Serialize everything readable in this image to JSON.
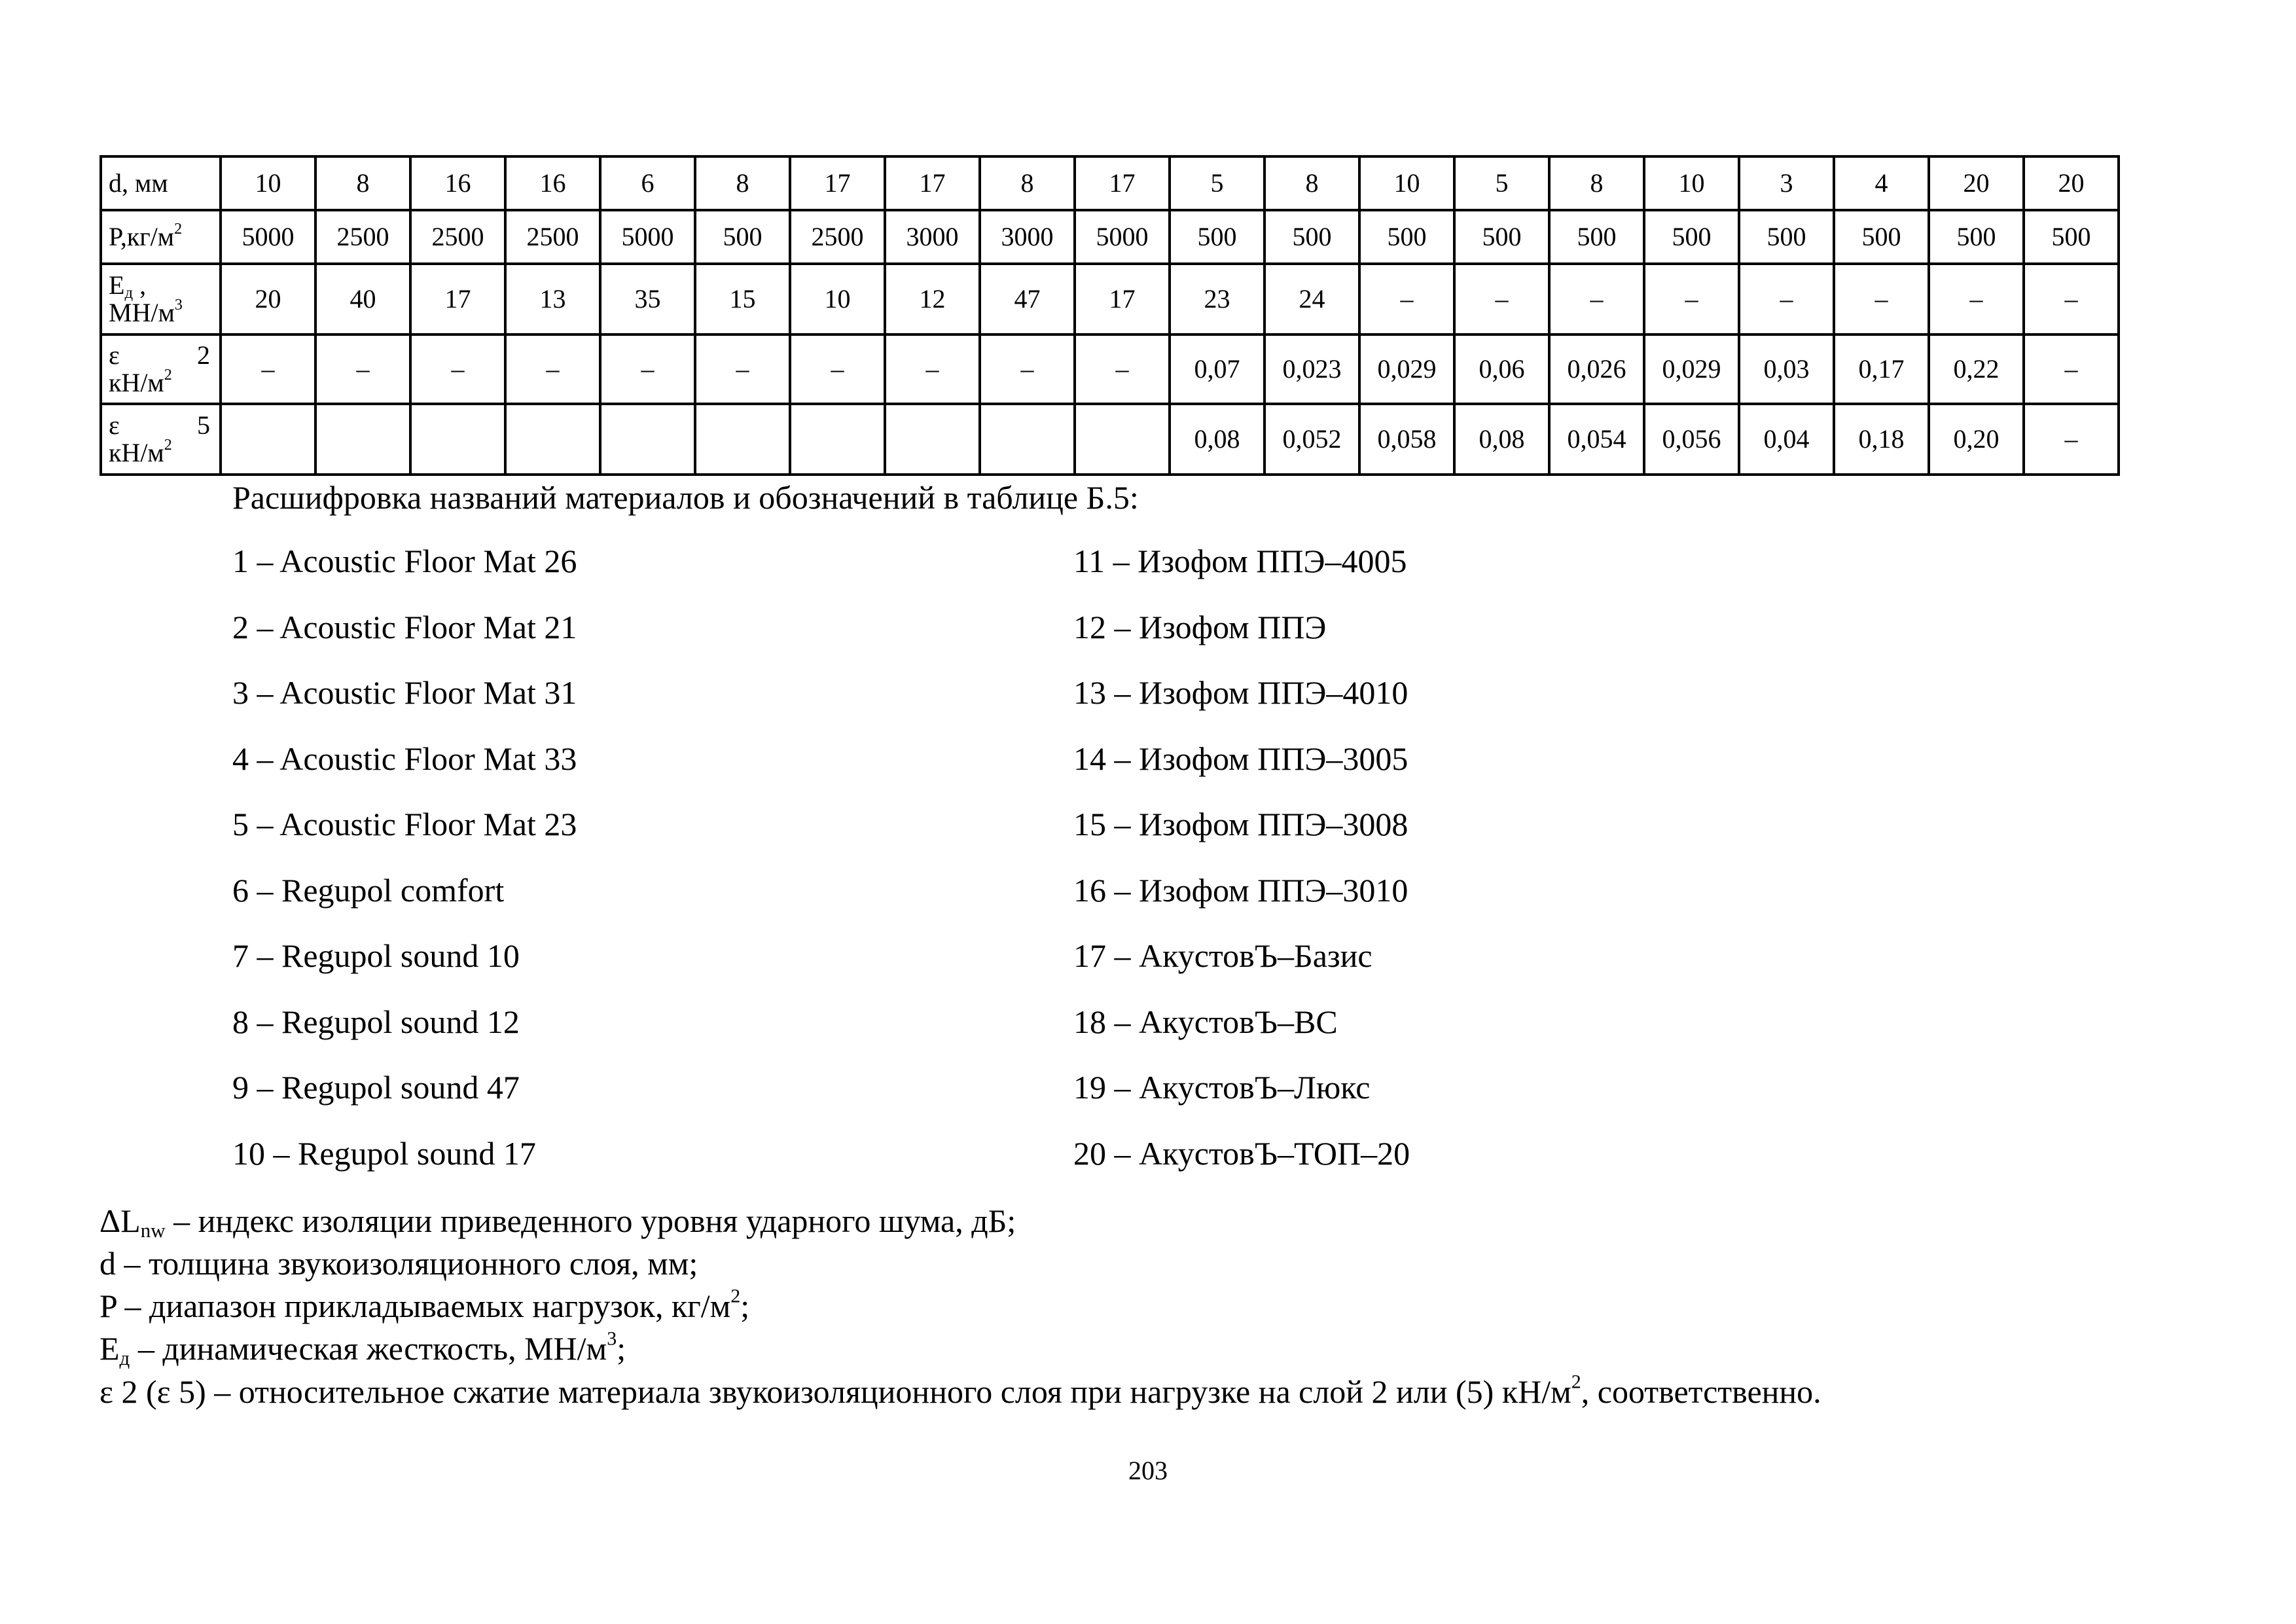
{
  "table": {
    "rows": [
      {
        "label": "d, мм",
        "label_sup": "",
        "label_line2": "",
        "label_line2_sup": "",
        "cells": [
          "10",
          "8",
          "16",
          "16",
          "6",
          "8",
          "17",
          "17",
          "8",
          "17",
          "5",
          "8",
          "10",
          "5",
          "8",
          "10",
          "3",
          "4",
          "20",
          "20"
        ]
      },
      {
        "label": "P,кг/м",
        "label_sup": "2",
        "label_line2": "",
        "label_line2_sup": "",
        "cells": [
          "5000",
          "2500",
          "2500",
          "2500",
          "5000",
          "500",
          "2500",
          "3000",
          "3000",
          "5000",
          "500",
          "500",
          "500",
          "500",
          "500",
          "500",
          "500",
          "500",
          "500",
          "500"
        ]
      },
      {
        "label": "E",
        "label_sub": "д",
        "label_after_sub": " ,",
        "label_line2": "МН/м",
        "label_line2_sup": "3",
        "cells": [
          "20",
          "40",
          "17",
          "13",
          "35",
          "15",
          "10",
          "12",
          "47",
          "17",
          "23",
          "24",
          "–",
          "–",
          "–",
          "–",
          "–",
          "–",
          "–",
          "–"
        ]
      },
      {
        "label": "ε",
        "label_right": "2",
        "label_line2": "кН/м",
        "label_line2_sup": "2",
        "cells": [
          "–",
          "–",
          "–",
          "–",
          "–",
          "–",
          "–",
          "–",
          "–",
          "–",
          "0,07",
          "0,023",
          "0,029",
          "0,06",
          "0,026",
          "0,029",
          "0,03",
          "0,17",
          "0,22",
          "–"
        ]
      },
      {
        "label": "ε",
        "label_right": "5",
        "label_line2": "кН/м",
        "label_line2_sup": "2",
        "cells": [
          "",
          "",
          "",
          "",
          "",
          "",
          "",
          "",
          "",
          "",
          "0,08",
          "0,052",
          "0,058",
          "0,08",
          "0,054",
          "0,056",
          "0,04",
          "0,18",
          "0,20",
          "–"
        ]
      }
    ]
  },
  "caption": "Расшифровка названий материалов и обозначений в таблице Б.5:",
  "materials_left": [
    "1 – Acoustic Floor Mat 26",
    "2 – Acoustic Floor Mat 21",
    "3 – Acoustic Floor Mat 31",
    "4 – Acoustic Floor Mat 33",
    "5 – Acoustic Floor Mat 23",
    "6 – Regupol comfort",
    "7 – Regupol sound 10",
    "8 – Regupol sound 12",
    "9 – Regupol sound 47",
    "10 – Regupol sound 17"
  ],
  "materials_right": [
    "11 – Изофом ППЭ–4005",
    "12 – Изофом ППЭ",
    "13 – Изофом ППЭ–4010",
    "14 – Изофом ППЭ–3005",
    "15 – Изофом ППЭ–3008",
    "16 – Изофом ППЭ–3010",
    "17 – АкустовЪ–Базис",
    "18 – АкустовЪ–ВС",
    "19 – АкустовЪ–Люкс",
    "20 – АкустовЪ–ТОП–20"
  ],
  "notes": [
    {
      "pre": "ΔL",
      "sub": "nw",
      "text": " – индекс изоляции приведенного уровня ударного шума, дБ;",
      "sup": "",
      "post": ""
    },
    {
      "pre": "d",
      "sub": "",
      "text": " – толщина звукоизоляционного слоя, мм;",
      "sup": "",
      "post": ""
    },
    {
      "pre": "P",
      "sub": "",
      "text": " – диапазон прикладываемых нагрузок, кг/м",
      "sup": "2",
      "post": ";"
    },
    {
      "pre": "E",
      "sub": "д",
      "text": " –  динамическая жесткость, МН/м",
      "sup": "3",
      "post": ";"
    },
    {
      "pre": "ε 2 (ε 5)",
      "sub": "",
      "text": " – относительное сжатие материала звукоизоляционного слоя при нагрузке на слой 2 или  (5) кН/м",
      "sup": "2",
      "post": ", соответственно."
    }
  ],
  "page_number": "203"
}
